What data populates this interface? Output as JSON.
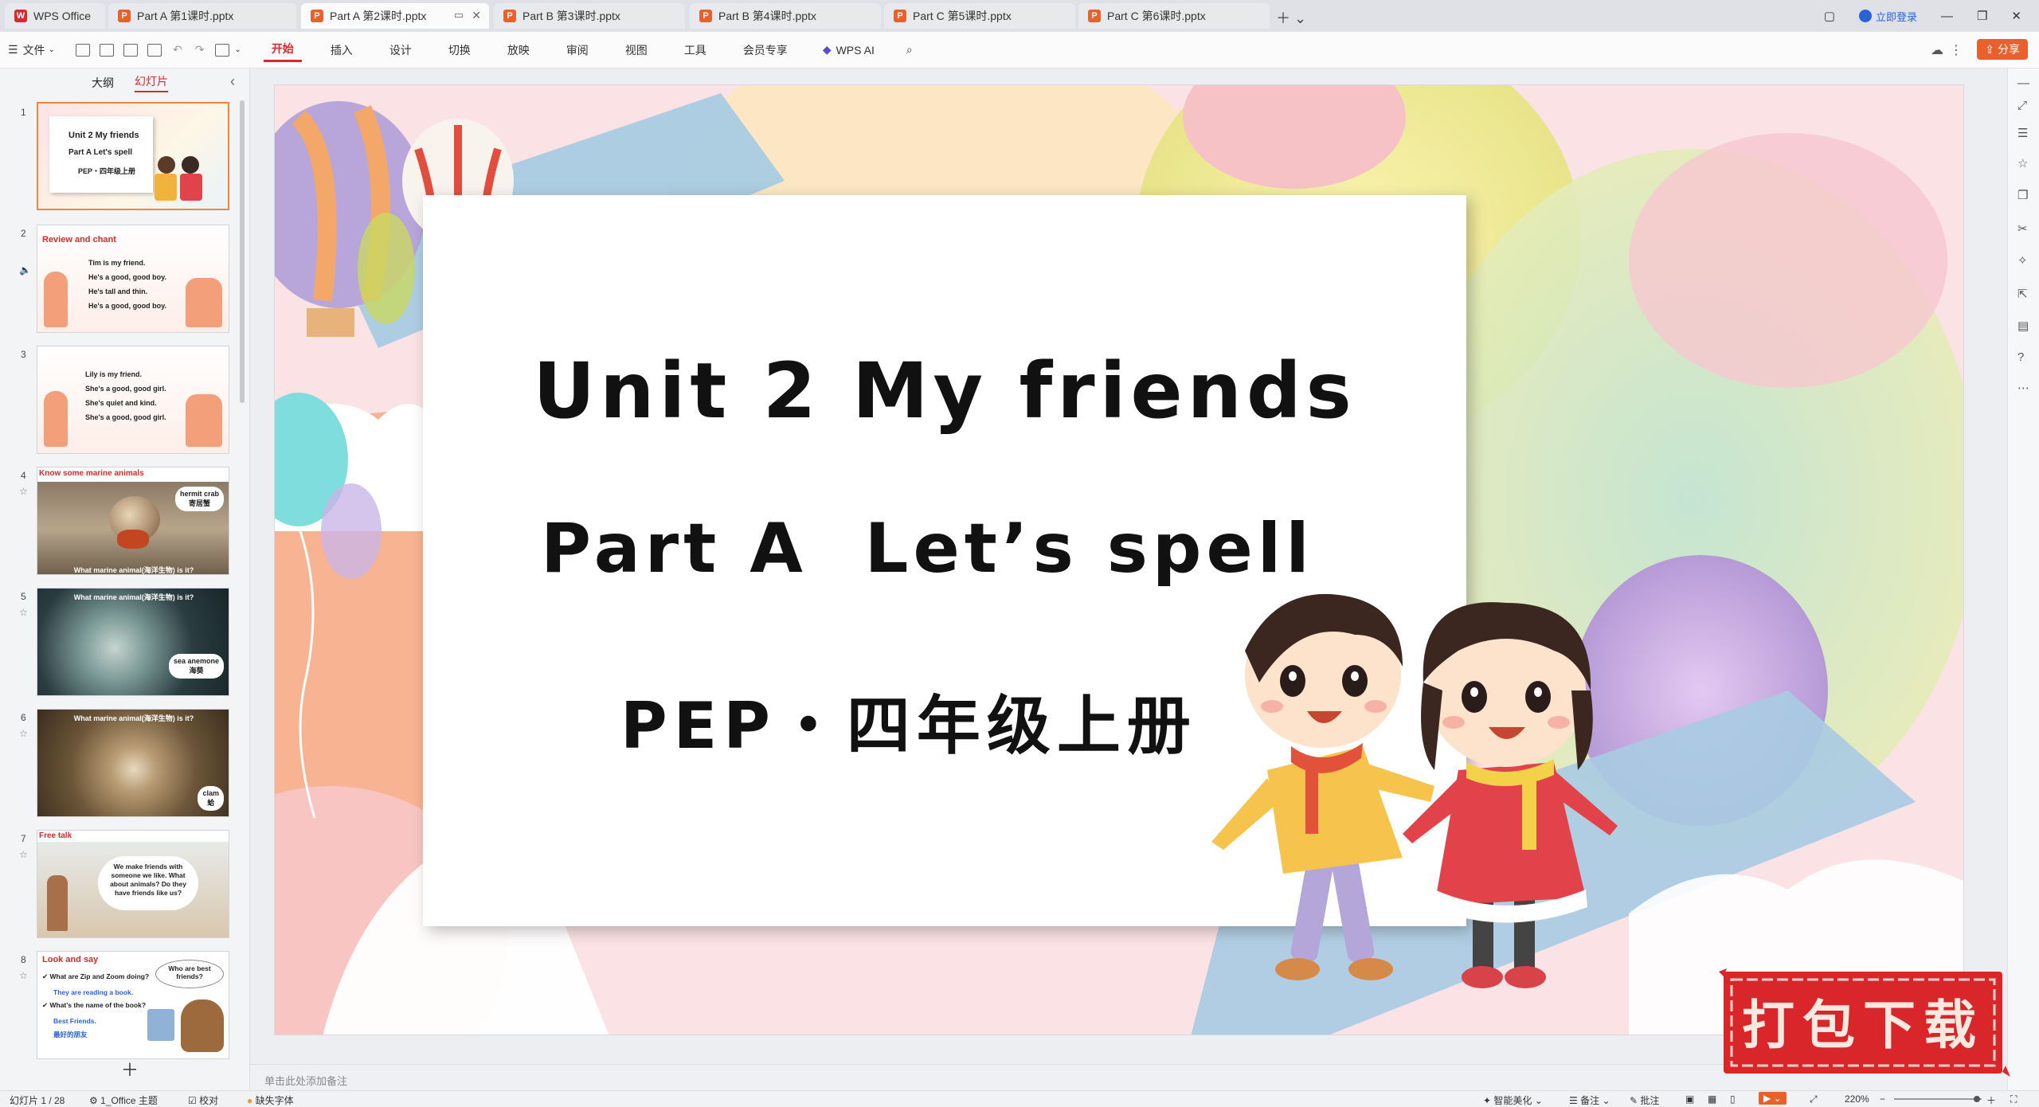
{
  "tabs": [
    {
      "label": "WPS Office",
      "icon": "wps-logo-icon"
    },
    {
      "label": "Part A 第1课时.pptx",
      "icon": "ppt-file-icon"
    },
    {
      "label": "Part A 第2课时.pptx",
      "icon": "ppt-file-icon"
    },
    {
      "label": "Part B 第3课时.pptx",
      "icon": "ppt-file-icon"
    },
    {
      "label": "Part B 第4课时.pptx",
      "icon": "ppt-file-icon"
    },
    {
      "label": "Part C 第5课时.pptx",
      "icon": "ppt-file-icon"
    },
    {
      "label": "Part C 第6课时.pptx",
      "icon": "ppt-file-icon"
    }
  ],
  "window": {
    "login": "立即登录"
  },
  "ribbon": {
    "file_menu": "文件",
    "tabs": [
      "开始",
      "插入",
      "设计",
      "切换",
      "放映",
      "审阅",
      "视图",
      "工具",
      "会员专享"
    ],
    "ai": "WPS AI",
    "share": "分享"
  },
  "panel": {
    "outline_tab": "大纲",
    "slides_tab": "幻灯片"
  },
  "slides": {
    "s1": {
      "title": "Unit 2 My friends",
      "sub": "Part A  Let's spell",
      "pep": "PEP・四年级上册"
    },
    "s2": {
      "title": "Review and chant",
      "lines": [
        "Tim is my friend.",
        "He's a good, good boy.",
        "He's tall and thin.",
        "He's a good, good boy."
      ]
    },
    "s3": {
      "lines": [
        "Lily is my friend.",
        "She's a good, good girl.",
        "She's quiet and kind.",
        "She's a good, good girl."
      ]
    },
    "s4": {
      "title": "Know some marine animals",
      "bubble_en": "hermit crab",
      "bubble_cn": "寄居蟹",
      "caption": "What marine animal(海洋生物) is it?"
    },
    "s5": {
      "caption": "What marine animal(海洋生物) is it?",
      "bubble_en": "sea anemone",
      "bubble_cn": "海葵"
    },
    "s6": {
      "caption": "What marine animal(海洋生物) is it?",
      "bubble_en": "clam",
      "bubble_cn": "蛤"
    },
    "s7": {
      "title": "Free talk",
      "bubble": "We make friends with someone we like. What about animals? Do they have friends like us?"
    },
    "s8": {
      "title": "Look and say",
      "q1": "What are Zip and Zoom doing?",
      "a1": "They are reading a book.",
      "q2": "What's the name of the book?",
      "a2": "Best Friends.",
      "a2_cn": "最好的朋友",
      "bubble": "Who are best friends?"
    }
  },
  "main_slide": {
    "title": "Unit 2 My friends",
    "subtitle": "Part A  Let’s spell",
    "pep": "PEP・四年级上册"
  },
  "watermark": "打包下载",
  "notes_placeholder": "单击此处添加备注",
  "status": {
    "slide_count": "幻灯片 1 / 28",
    "theme": "1_Office 主题",
    "proof": "校对",
    "missing_font": "缺失字体",
    "beautify": "智能美化",
    "notes": "备注",
    "comments": "批注",
    "zoom": "220%"
  },
  "colors": {
    "accent": "#d9282f",
    "share": "#e8602c",
    "title_red": "#d52b2b"
  }
}
